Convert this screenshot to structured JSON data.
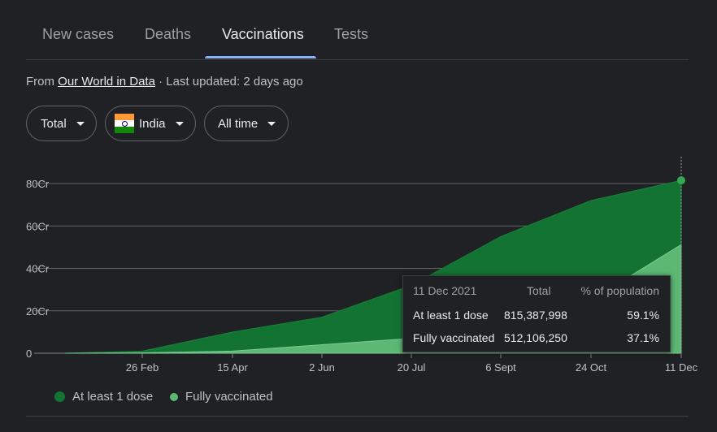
{
  "tabs": [
    {
      "label": "New cases"
    },
    {
      "label": "Deaths"
    },
    {
      "label": "Vaccinations"
    },
    {
      "label": "Tests"
    }
  ],
  "active_tab": "Vaccinations",
  "source": {
    "prefix": "From ",
    "link": "Our World in Data",
    "suffix": " · Last updated: 2 days ago"
  },
  "filters": {
    "metric": "Total",
    "country": "India",
    "range": "All time"
  },
  "chart_data": {
    "type": "area",
    "x_ticks": [
      "26 Feb",
      "15 Apr",
      "2 Jun",
      "20 Jul",
      "6 Sept",
      "24 Oct",
      "11 Dec"
    ],
    "y_ticks": [
      "80Cr",
      "60Cr",
      "40Cr",
      "20Cr",
      "0"
    ],
    "ylim": [
      0,
      80
    ],
    "series": [
      {
        "name": "At least 1 dose",
        "color": "#137333",
        "x": [
          "16 Jan",
          "26 Feb",
          "15 Apr",
          "2 Jun",
          "20 Jul",
          "6 Sept",
          "24 Oct",
          "11 Dec"
        ],
        "values": [
          0,
          1,
          10,
          17,
          32,
          55,
          72,
          81.5
        ]
      },
      {
        "name": "Fully vaccinated",
        "color": "#5bb974",
        "x": [
          "16 Jan",
          "26 Feb",
          "15 Apr",
          "2 Jun",
          "20 Jul",
          "6 Sept",
          "24 Oct",
          "11 Dec"
        ],
        "values": [
          0,
          0.2,
          1,
          4,
          7,
          13,
          25,
          51.2
        ]
      }
    ],
    "legend_position": "bottom-left",
    "grid": true
  },
  "tooltip": {
    "date": "11 Dec 2021",
    "col_total": "Total",
    "col_pct": "% of population",
    "rows": [
      {
        "label": "At least 1 dose",
        "total": "815,387,998",
        "pct": "59.1%"
      },
      {
        "label": "Fully vaccinated",
        "total": "512,106,250",
        "pct": "37.1%"
      }
    ]
  },
  "legend": [
    {
      "label": "At least 1 dose",
      "color": "#137333"
    },
    {
      "label": "Fully vaccinated",
      "color": "#5bb974"
    }
  ]
}
